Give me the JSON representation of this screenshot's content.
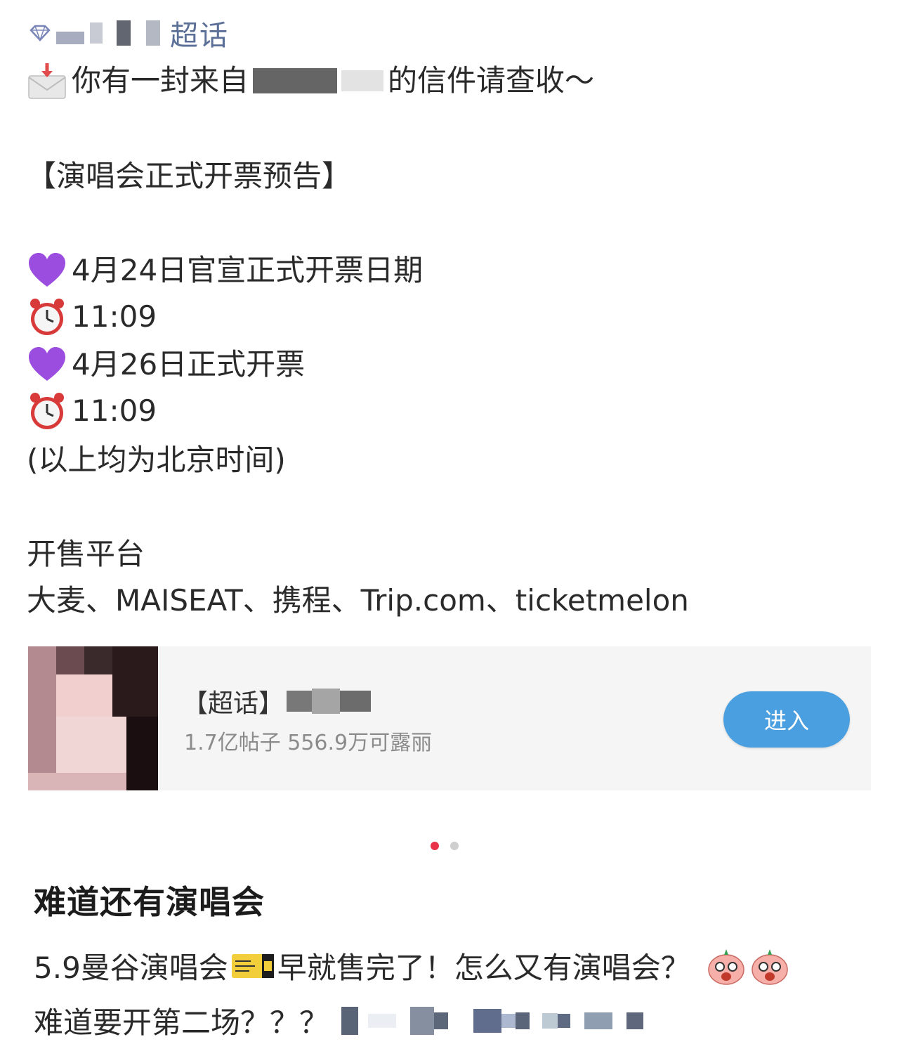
{
  "topic": {
    "label": "超话",
    "icon": "diamond-icon"
  },
  "post_image": {
    "mail_line": {
      "prefix": "你有一封来自",
      "suffix": "的信件请查收～"
    },
    "announcement": "【演唱会正式开票预告】",
    "schedule": [
      {
        "icon": "purple-heart-icon",
        "text": "4月24日官宣正式开票日期"
      },
      {
        "icon": "alarm-clock-icon",
        "text": "11:09"
      },
      {
        "icon": "purple-heart-icon",
        "text": "4月26日正式开票"
      },
      {
        "icon": "alarm-clock-icon",
        "text": "11:09"
      }
    ],
    "timezone_note": "(以上均为北京时间)",
    "platform_heading": "开售平台",
    "platform_list": "大麦、MAISEAT、携程、Trip.com、ticketmelon",
    "card": {
      "title_prefix": "【超话】",
      "stats": "1.7亿帖子 556.9万可露丽",
      "enter_label": "进入"
    }
  },
  "pagination": {
    "count": 2,
    "active": 1
  },
  "post": {
    "title": "难道还有演唱会",
    "line1_a": "5.9曼谷演唱会",
    "line1_b": "早就售完了！怎么又有演唱会？",
    "line2": "难道要开第二场？？？"
  },
  "colors": {
    "accent_red": "#e8334a",
    "button_blue": "#4a9fe0",
    "topic_blue": "#5b6f97",
    "heart_purple": "#9b4de0"
  }
}
